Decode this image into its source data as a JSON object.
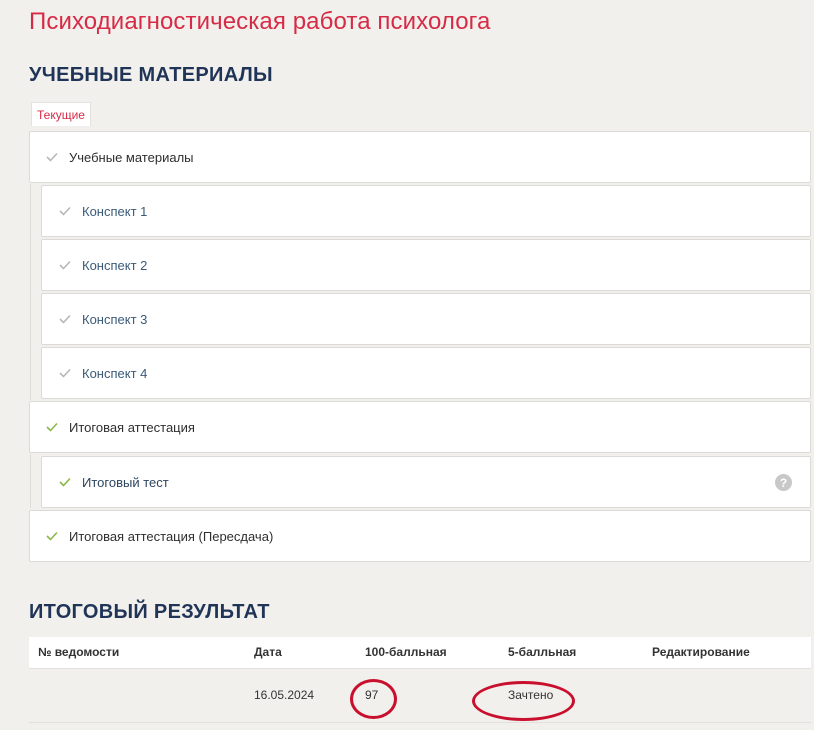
{
  "page": {
    "title": "Психодиагностическая работа психолога"
  },
  "materials": {
    "heading": "УЧЕБНЫЕ МАТЕРИАЛЫ",
    "tab_label": "Текущие",
    "items": [
      {
        "label": "Учебные материалы",
        "level": 0,
        "state": "pending"
      },
      {
        "label": "Конспект 1",
        "level": 1,
        "state": "pending"
      },
      {
        "label": "Конспект 2",
        "level": 1,
        "state": "pending"
      },
      {
        "label": "Конспект 3",
        "level": 1,
        "state": "pending"
      },
      {
        "label": "Конспект 4",
        "level": 1,
        "state": "pending"
      },
      {
        "label": "Итоговая аттестация",
        "level": 0,
        "state": "done"
      },
      {
        "label": "Итоговый тест",
        "level": 1,
        "state": "done",
        "help": "?"
      },
      {
        "label": "Итоговая аттестация (Пересдача)",
        "level": 0,
        "state": "done"
      }
    ]
  },
  "results": {
    "heading": "ИТОГОВЫЙ РЕЗУЛЬТАТ",
    "columns": [
      "№ ведомости",
      "Дата",
      "100-балльная",
      "5-балльная",
      "Редактирование"
    ],
    "rows": [
      {
        "number": "",
        "date": "16.05.2024",
        "score100": "97",
        "score5": "Зачтено",
        "edit": ""
      }
    ]
  },
  "colors": {
    "accent": "#d62b46",
    "heading": "#1f3457",
    "check_pending": "#b8b8b8",
    "check_done": "#8ab84a",
    "annotation": "#c8102e"
  }
}
